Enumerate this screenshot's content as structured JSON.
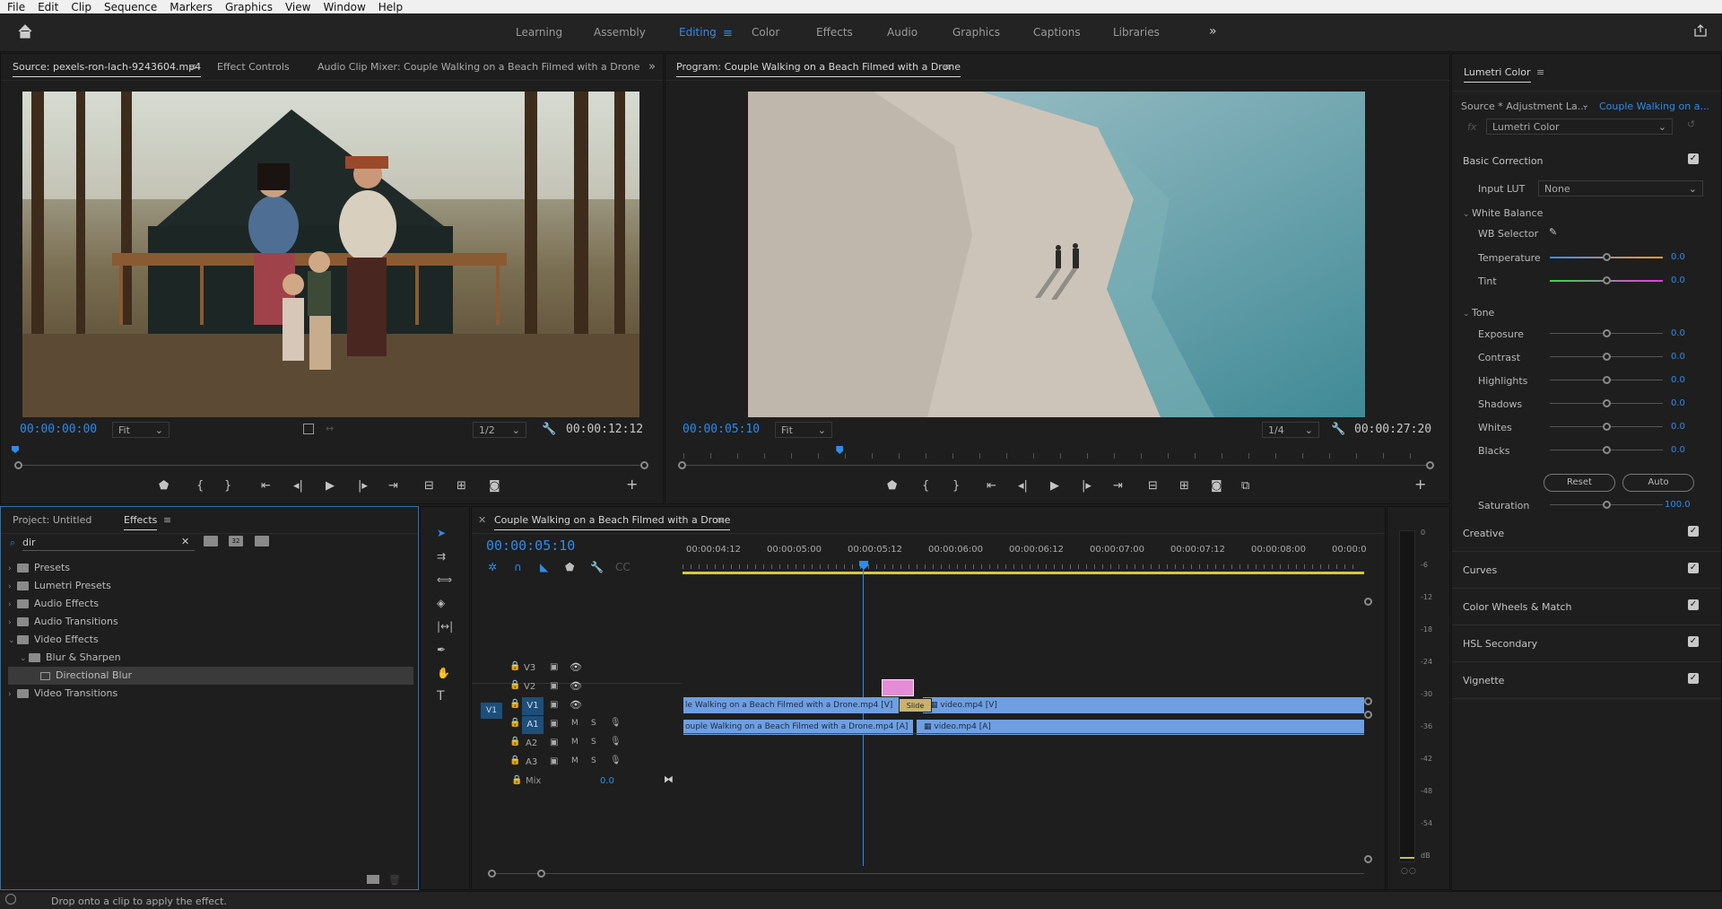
{
  "menu": [
    "File",
    "Edit",
    "Clip",
    "Sequence",
    "Markers",
    "Graphics",
    "View",
    "Window",
    "Help"
  ],
  "workspaces": [
    {
      "label": "Learning",
      "active": false
    },
    {
      "label": "Assembly",
      "active": false
    },
    {
      "label": "Editing",
      "active": true
    },
    {
      "label": "Color",
      "active": false
    },
    {
      "label": "Effects",
      "active": false
    },
    {
      "label": "Audio",
      "active": false
    },
    {
      "label": "Graphics",
      "active": false
    },
    {
      "label": "Captions",
      "active": false
    },
    {
      "label": "Libraries",
      "active": false
    }
  ],
  "source": {
    "tabs": [
      "Source: pexels-ron-lach-9243604.mp4",
      "Effect Controls",
      "Audio Clip Mixer: Couple Walking on a Beach Filmed with a Drone"
    ],
    "timecode": "00:00:00:00",
    "fit": "Fit",
    "resolution": "1/2",
    "duration": "00:00:12:12"
  },
  "program": {
    "title": "Program: Couple Walking on a Beach Filmed with a Drone",
    "timecode": "00:00:05:10",
    "fit": "Fit",
    "resolution": "1/4",
    "duration": "00:00:27:20",
    "playhead": 0.21
  },
  "lumetri": {
    "title": "Lumetri Color",
    "source": "Source * Adjustment La...",
    "target": "Couple Walking on a...",
    "effect": "Lumetri Color",
    "basic_correction": "Basic Correction",
    "input_lut_label": "Input LUT",
    "input_lut": "None",
    "white_balance": "White Balance",
    "wb_selector": "WB Selector",
    "temperature": {
      "label": "Temperature",
      "value": "0.0"
    },
    "tint": {
      "label": "Tint",
      "value": "0.0"
    },
    "tone": "Tone",
    "tone_rows": [
      {
        "label": "Exposure",
        "value": "0.0"
      },
      {
        "label": "Contrast",
        "value": "0.0"
      },
      {
        "label": "Highlights",
        "value": "0.0"
      },
      {
        "label": "Shadows",
        "value": "0.0"
      },
      {
        "label": "Whites",
        "value": "0.0"
      },
      {
        "label": "Blacks",
        "value": "0.0"
      }
    ],
    "reset": "Reset",
    "auto": "Auto",
    "saturation": {
      "label": "Saturation",
      "value": "100.0"
    },
    "sections": [
      "Creative",
      "Curves",
      "Color Wheels & Match",
      "HSL Secondary",
      "Vignette"
    ]
  },
  "project": {
    "tabs": [
      "Project: Untitled",
      "Effects"
    ],
    "search": "dir",
    "tree": [
      {
        "label": "Presets",
        "depth": 0,
        "open": false
      },
      {
        "label": "Lumetri Presets",
        "depth": 0,
        "open": false
      },
      {
        "label": "Audio Effects",
        "depth": 0,
        "open": false
      },
      {
        "label": "Audio Transitions",
        "depth": 0,
        "open": false
      },
      {
        "label": "Video Effects",
        "depth": 0,
        "open": true
      },
      {
        "label": "Blur & Sharpen",
        "depth": 1,
        "open": true
      },
      {
        "label": "Directional Blur",
        "depth": 2,
        "open": false,
        "selected": true
      },
      {
        "label": "Video Transitions",
        "depth": 0,
        "open": false
      }
    ]
  },
  "timeline": {
    "title": "Couple Walking on a Beach Filmed with a Drone",
    "timecode": "00:00:05:10",
    "ruler": [
      "00:00:04:12",
      "00:00:05:00",
      "00:00:05:12",
      "00:00:06:00",
      "00:00:06:12",
      "00:00:07:00",
      "00:00:07:12",
      "00:00:08:00",
      "00:00:0"
    ],
    "video_tracks": [
      "V3",
      "V2",
      "V1"
    ],
    "audio_tracks": [
      "A1",
      "A2",
      "A3"
    ],
    "mix_label": "Mix",
    "mix_value": "0.0",
    "clip_v1_a": "le Walking on a Beach Filmed with a Drone.mp4 [V]",
    "clip_v1_b": "video.mp4 [V]",
    "clip_a1_a": "ouple Walking on a Beach Filmed with a Drone.mp4 [A]",
    "clip_a1_b": "video.mp4 [A]",
    "transition": "Slide"
  },
  "meter": {
    "ticks": [
      "0",
      "-6",
      "-12",
      "-18",
      "-24",
      "-30",
      "-36",
      "-42",
      "-48",
      "-54",
      "dB"
    ]
  },
  "status": "Drop onto a clip to apply the effect."
}
